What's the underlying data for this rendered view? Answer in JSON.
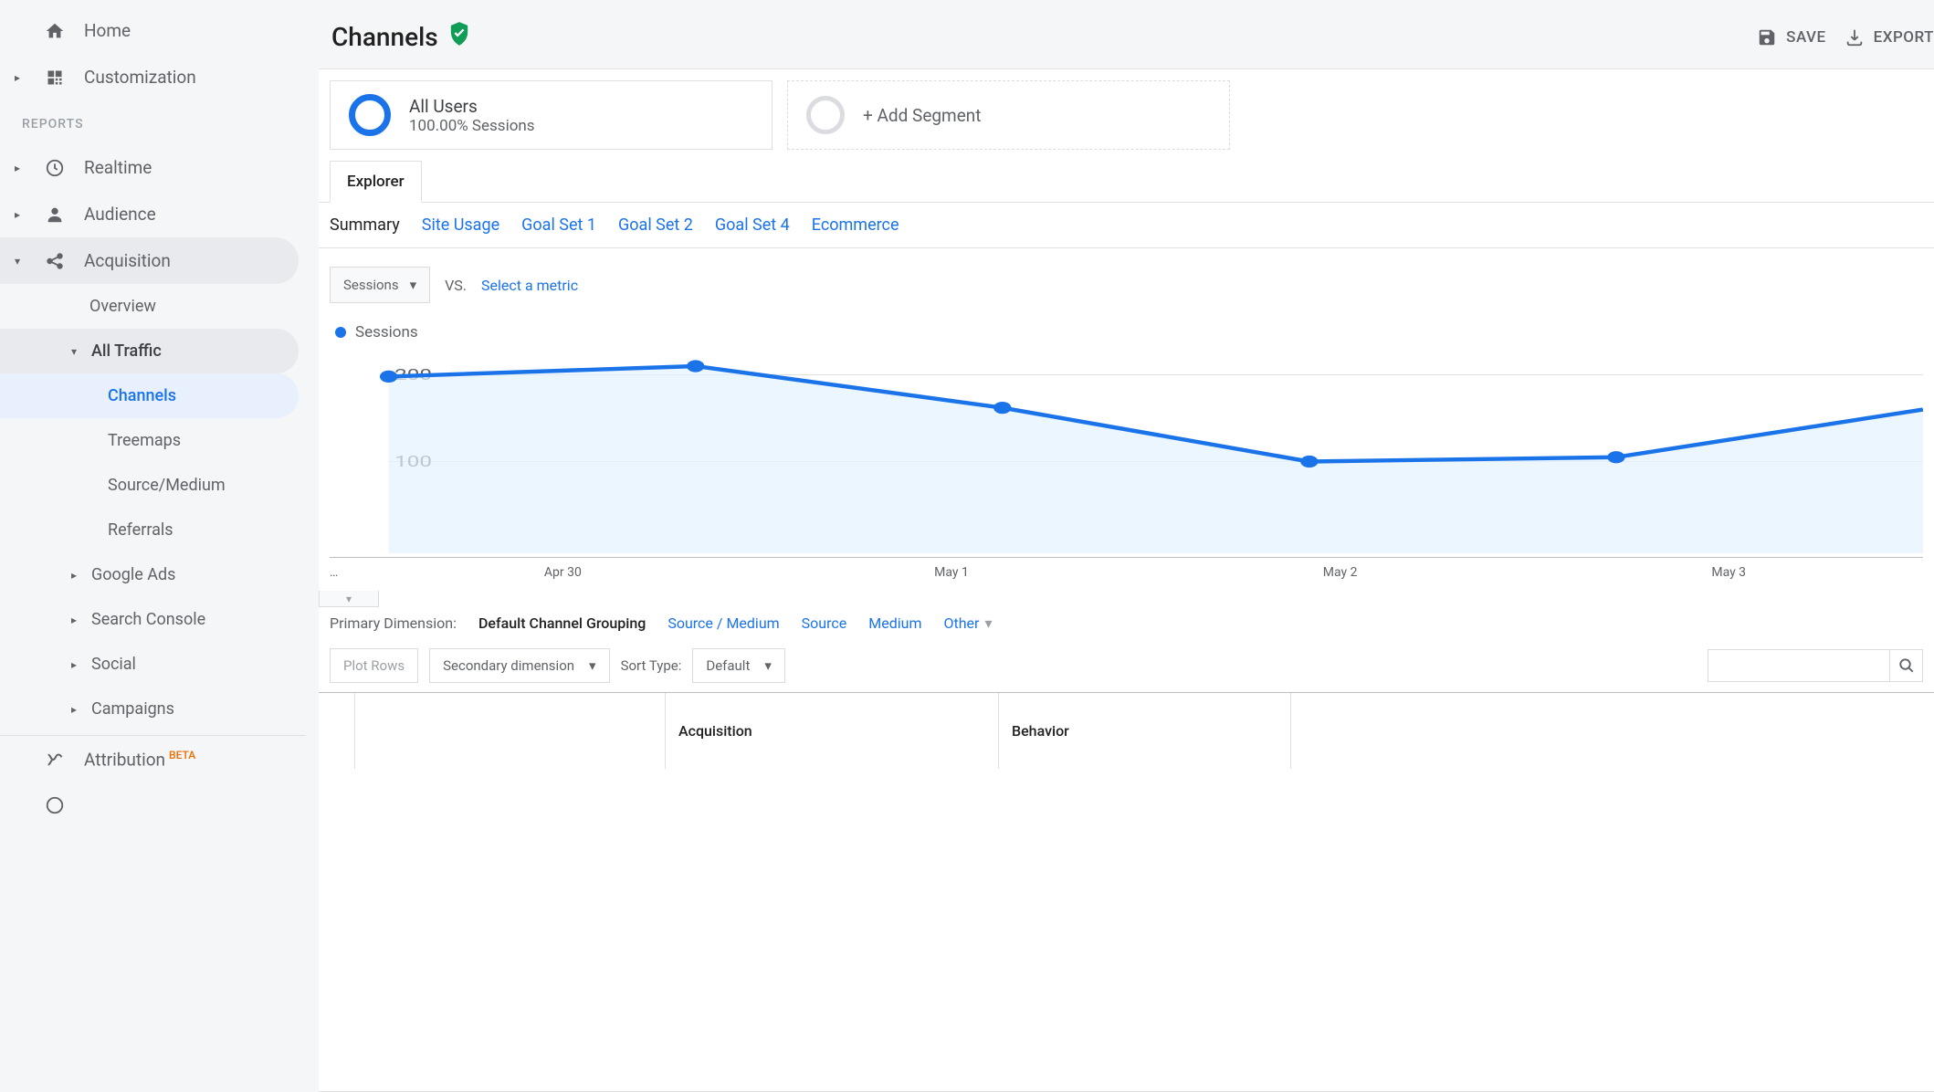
{
  "sidebar": {
    "home": "Home",
    "customization": "Customization",
    "reports_label": "REPORTS",
    "realtime": "Realtime",
    "audience": "Audience",
    "acquisition": "Acquisition",
    "acq_children": {
      "overview": "Overview",
      "all_traffic": "All Traffic",
      "channels": "Channels",
      "treemaps": "Treemaps",
      "source_medium": "Source/Medium",
      "referrals": "Referrals",
      "google_ads": "Google Ads",
      "search_console": "Search Console",
      "social": "Social",
      "campaigns": "Campaigns"
    },
    "attribution": "Attribution",
    "attribution_badge": "BETA"
  },
  "header": {
    "title": "Channels",
    "save": "SAVE",
    "export": "EXPORT"
  },
  "segments": {
    "all_users_title": "All Users",
    "all_users_sub": "100.00% Sessions",
    "add_segment": "+ Add Segment"
  },
  "tabs": {
    "explorer": "Explorer"
  },
  "subtabs": {
    "summary": "Summary",
    "site_usage": "Site Usage",
    "goal_set_1": "Goal Set 1",
    "goal_set_2": "Goal Set 2",
    "goal_set_4": "Goal Set 4",
    "ecommerce": "Ecommerce"
  },
  "metric": {
    "primary": "Sessions",
    "vs": "VS.",
    "select_link": "Select a metric",
    "legend": "Sessions"
  },
  "chart_data": {
    "type": "line",
    "categories": [
      "…",
      "Apr 30",
      "May 1",
      "May 2",
      "May 3"
    ],
    "values": [
      198,
      210,
      162,
      100,
      105
    ],
    "ylim": [
      0,
      220
    ],
    "y_ticks": [
      100,
      200
    ],
    "series_name": "Sessions",
    "color": "#1a73e8"
  },
  "dimension": {
    "label": "Primary Dimension:",
    "active": "Default Channel Grouping",
    "source_medium": "Source / Medium",
    "source": "Source",
    "medium": "Medium",
    "other": "Other"
  },
  "controls": {
    "plot_rows": "Plot Rows",
    "secondary_dim": "Secondary dimension",
    "sort_label": "Sort Type:",
    "sort_value": "Default",
    "search_placeholder": ""
  },
  "table": {
    "acquisition": "Acquisition",
    "behavior": "Behavior"
  }
}
